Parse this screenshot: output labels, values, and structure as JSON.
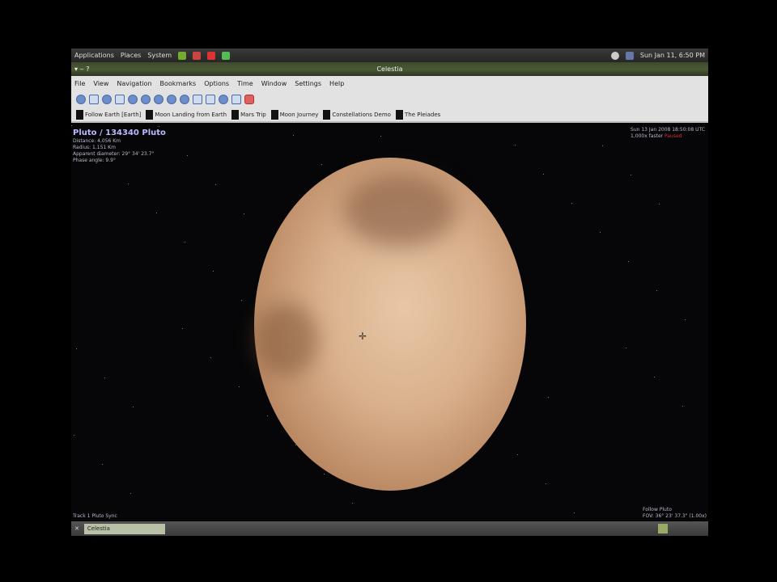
{
  "panel": {
    "menus": [
      "Applications",
      "Places",
      "System"
    ],
    "clock": "Sun Jan 11, 6:50 PM"
  },
  "window": {
    "title": "Celestia"
  },
  "menubar": [
    "File",
    "View",
    "Navigation",
    "Bookmarks",
    "Options",
    "Time",
    "Window",
    "Settings",
    "Help"
  ],
  "bookmarks": [
    "Follow Earth [Earth]",
    "Moon Landing from Earth",
    "Mars Trip",
    "Moon Journey",
    "Constellations Demo",
    "The Pleiades"
  ],
  "info": {
    "name": "Pluto / 134340 Pluto",
    "lines": [
      "Distance: 4,056 Km",
      "Radius: 1,151 Km",
      "Apparent diameter: 29° 34' 23.7\"",
      "Phase angle: 9.9°"
    ]
  },
  "topright": {
    "line1": "Sun 13 Jan 2008 18:50:08 UTC",
    "line2": "1,000x faster",
    "paused": "Paused"
  },
  "bottomleft": "Track 1 Pluto Sync",
  "bottomright": {
    "line1": "Follow Pluto",
    "line2": "FOV: 36° 23' 37.3\" (1.00x)"
  },
  "taskbar": {
    "item": "Celestia"
  }
}
